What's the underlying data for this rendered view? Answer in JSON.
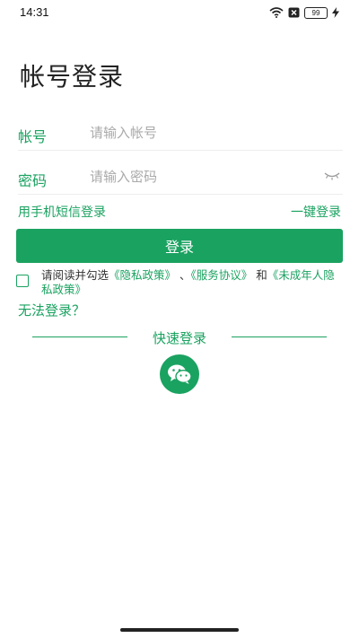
{
  "status_bar": {
    "time": "14:31",
    "battery": "99",
    "icons": [
      "wifi-icon",
      "close-box-icon",
      "battery-icon",
      "charging-icon"
    ]
  },
  "title": "帐号登录",
  "account": {
    "label": "帐号",
    "placeholder": "请输入帐号",
    "value": ""
  },
  "password": {
    "label": "密码",
    "placeholder": "请输入密码",
    "value": ""
  },
  "links": {
    "sms_login": "用手机短信登录",
    "one_click_login": "一键登录"
  },
  "login_button": "登录",
  "agreement": {
    "prefix": "请阅读并勾选",
    "privacy": "《隐私政策》",
    "sep1": " 、",
    "service": "《服务协议》",
    "and": " 和",
    "minor_privacy": "《未成年人隐私政策》",
    "checked": false
  },
  "cant_login": "无法登录？",
  "quick_login": {
    "label": "快速登录",
    "provider_icon": "wechat-icon"
  },
  "colors": {
    "accent": "#1aa260",
    "placeholder": "#aaaaaa",
    "text": "#222222"
  }
}
